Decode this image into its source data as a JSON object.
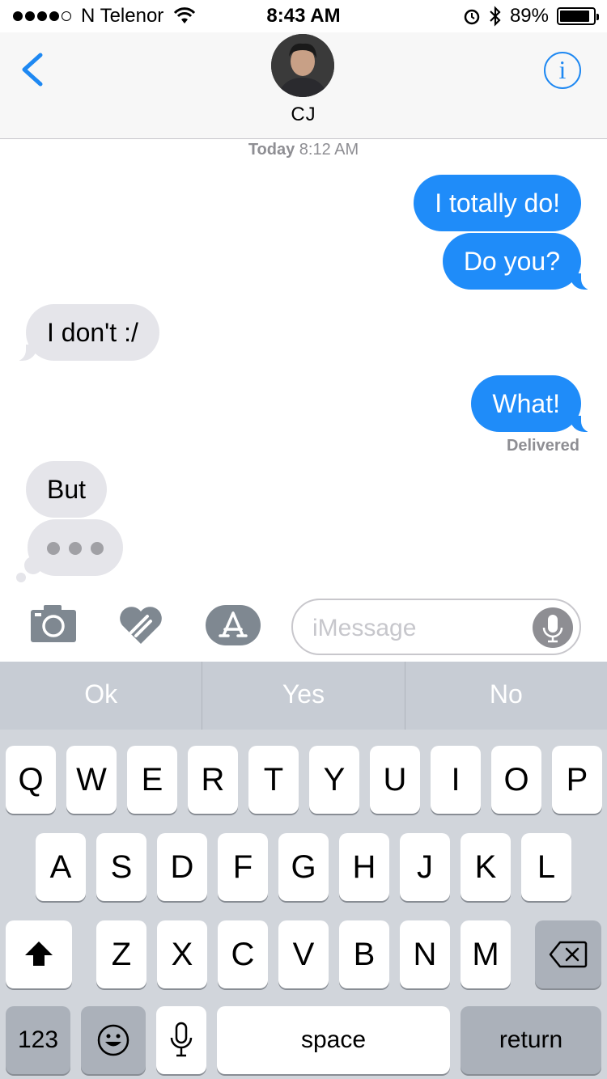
{
  "status_bar": {
    "carrier": "N Telenor",
    "time": "8:43 AM",
    "battery_percent": "89%",
    "battery_level": 0.89,
    "signal_bars": 4
  },
  "header": {
    "contact_name": "CJ",
    "back_icon": "chevron-left-icon",
    "info_glyph": "i"
  },
  "conversation": {
    "timestamp_day": "Today",
    "timestamp_time": "8:12 AM",
    "messages": [
      {
        "text": "I totally do!",
        "direction": "outgoing"
      },
      {
        "text": "Do you?",
        "direction": "outgoing"
      },
      {
        "text": "I don't :/",
        "direction": "incoming"
      },
      {
        "text": "What!",
        "direction": "outgoing"
      },
      {
        "text": "But",
        "direction": "incoming"
      }
    ],
    "delivered_label": "Delivered",
    "typing_indicator": true
  },
  "input_bar": {
    "placeholder": "iMessage"
  },
  "suggestions": [
    "Ok",
    "Yes",
    "No"
  ],
  "keyboard": {
    "row1": [
      "Q",
      "W",
      "E",
      "R",
      "T",
      "Y",
      "U",
      "I",
      "O",
      "P"
    ],
    "row2": [
      "A",
      "S",
      "D",
      "F",
      "G",
      "H",
      "J",
      "K",
      "L"
    ],
    "row3": [
      "Z",
      "X",
      "C",
      "V",
      "B",
      "N",
      "M"
    ],
    "numbers_label": "123",
    "space_label": "space",
    "return_label": "return"
  },
  "colors": {
    "accent": "#1e88f2",
    "outgoing_bubble": "#1f8cf9",
    "incoming_bubble": "#e5e5ea"
  }
}
